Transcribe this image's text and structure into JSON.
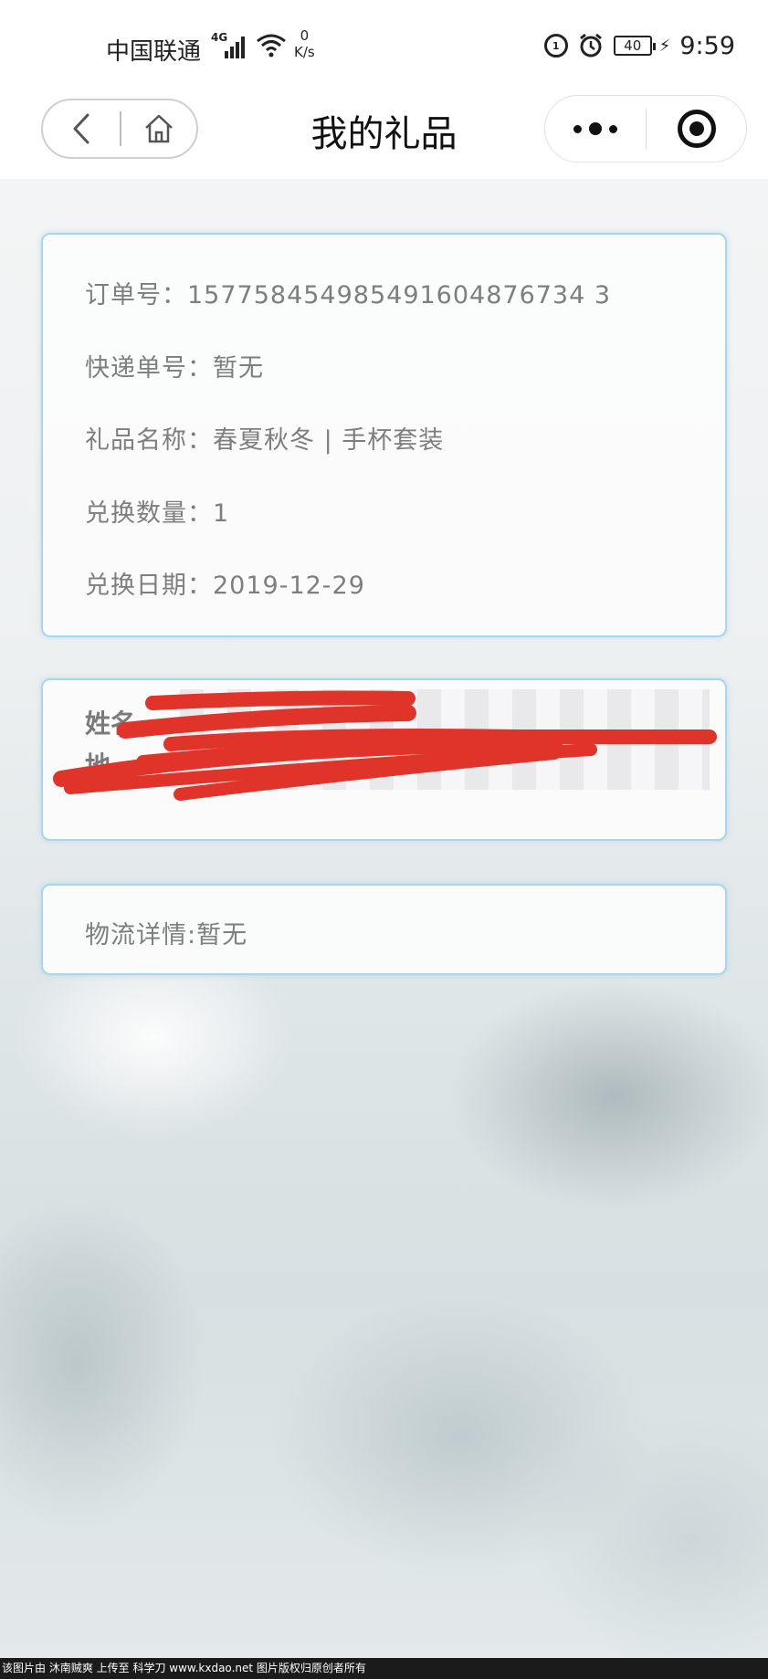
{
  "status_bar": {
    "carrier": "中国联通",
    "network": "4G",
    "speed_value": "0",
    "speed_unit": "K/s",
    "battery": "40",
    "time": "9:59"
  },
  "nav": {
    "title": "我的礼品"
  },
  "order": {
    "order_no_label": "订单号：",
    "order_no": "157758454985491604876734 3",
    "tracking_label": "快递单号：",
    "tracking": "暂无",
    "gift_name_label": "礼品名称：",
    "gift_name": "春夏秋冬 | 手杯套装",
    "quantity_label": "兑换数量：",
    "quantity": "1",
    "date_label": "兑换日期：",
    "date": "2019-12-29"
  },
  "recipient": {
    "name_label": "姓名",
    "address_label": "地"
  },
  "logistics": {
    "text": "物流详情:暂无"
  },
  "footer": {
    "watermark": "该图片由 沐南贼爽 上传至 科学刀 www.kxdao.net 图片版权归原创者所有"
  },
  "colors": {
    "card_border": "#a9d6ea",
    "redaction": "#e0342a",
    "text_gray": "#7e7e7e"
  }
}
